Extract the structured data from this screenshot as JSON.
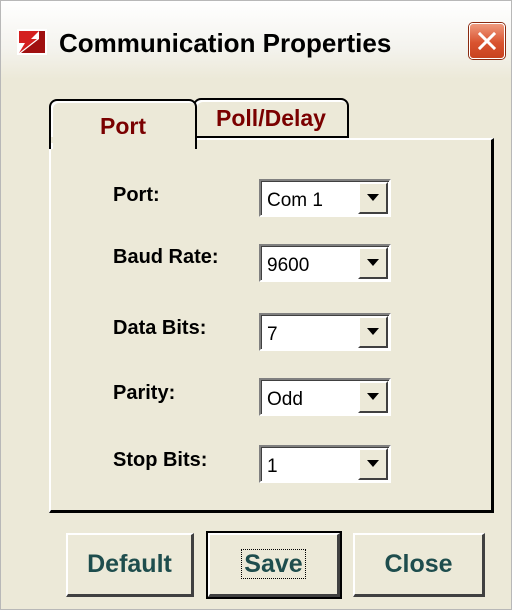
{
  "window": {
    "title": "Communication Properties",
    "app_icon": "app-logo-icon",
    "close_icon": "close-icon",
    "accent_color": "#7a0000"
  },
  "tabs": [
    {
      "label": "Port",
      "selected": true
    },
    {
      "label": "Poll/Delay",
      "selected": false
    }
  ],
  "fields": [
    {
      "label": "Port:",
      "value": "Com 1"
    },
    {
      "label": "Baud Rate:",
      "value": "9600"
    },
    {
      "label": "Data Bits:",
      "value": "7"
    },
    {
      "label": "Parity:",
      "value": "Odd"
    },
    {
      "label": "Stop Bits:",
      "value": "1"
    }
  ],
  "buttons": {
    "default_label": "Default",
    "save_label": "Save",
    "close_label": "Close"
  }
}
